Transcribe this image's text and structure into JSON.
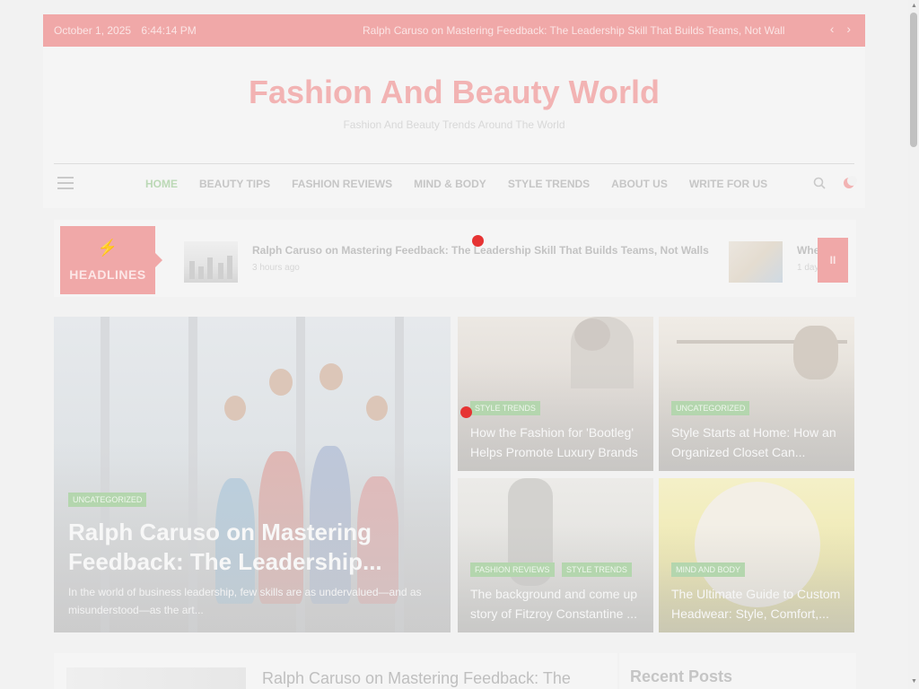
{
  "topbar": {
    "date": "October 1, 2025",
    "time": "6:44:14 PM",
    "ticker": "Ralph Caruso on Mastering Feedback: The Leadership Skill That Builds Teams, Not Walls",
    "prev": "‹",
    "next": "›"
  },
  "header": {
    "title": "Fashion And Beauty World",
    "tagline": "Fashion And Beauty Trends Around The World"
  },
  "nav": {
    "items": [
      {
        "label": "HOME",
        "active": true
      },
      {
        "label": "BEAUTY TIPS"
      },
      {
        "label": "FASHION REVIEWS"
      },
      {
        "label": "MIND & BODY"
      },
      {
        "label": "STYLE TRENDS"
      },
      {
        "label": "ABOUT US"
      },
      {
        "label": "WRITE FOR US"
      }
    ],
    "icons": [
      "menu-icon",
      "search-icon",
      "moon-icon"
    ]
  },
  "headlines": {
    "label": "HEADLINES",
    "bolt": "⚡",
    "items": [
      {
        "title": "Ralph Caruso on Mastering Feedback: The Leadership Skill That Builds Teams, Not Walls",
        "time": "3 hours ago"
      },
      {
        "title": "Whe",
        "time": "1 day"
      }
    ],
    "pause": "II"
  },
  "featured": {
    "main": {
      "tag": "UNCATEGORIZED",
      "title": "Ralph Caruso on Mastering Feedback: The Leadership...",
      "excerpt": "In the world of business leadership, few skills are as undervalued—and as misunderstood—as the art..."
    },
    "cards": [
      {
        "tags": [
          "STYLE TRENDS"
        ],
        "title": "How the Fashion for 'Bootleg' Helps Promote Luxury Brands"
      },
      {
        "tags": [
          "UNCATEGORIZED"
        ],
        "title": "Style Starts at Home: How an Organized Closet Can..."
      },
      {
        "tags": [
          "FASHION REVIEWS",
          "STYLE TRENDS"
        ],
        "title": "The background and come up story of Fitzroy Constantine ..."
      },
      {
        "tags": [
          "MIND AND BODY"
        ],
        "title": "The Ultimate Guide to Custom Headwear: Style, Comfort,..."
      }
    ]
  },
  "bottom": {
    "post_title": "Ralph Caruso on Mastering Feedback: The",
    "sidebar_title": "Recent Posts"
  },
  "colors": {
    "accent": "#f0a8a8",
    "tag_green": "#b4d6ae",
    "indicator_red": "#e63333"
  }
}
